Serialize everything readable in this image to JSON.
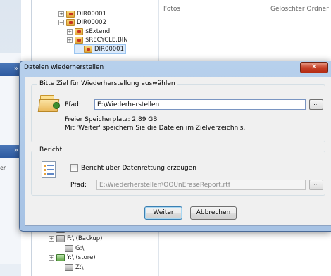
{
  "background": {
    "right_col_headers": [
      "Fotos",
      "Gelöschter Ordner"
    ],
    "left_partial_text": "er",
    "tree_top": [
      {
        "label": "DIR00001",
        "expander": "+",
        "icon": "red"
      },
      {
        "label": "DIR00002",
        "expander": "−",
        "icon": "red"
      },
      {
        "label": "$Extend",
        "expander": "+",
        "icon": "red"
      },
      {
        "label": "$RECYCLE.BIN",
        "expander": "+",
        "icon": "red"
      },
      {
        "label": "DIR00001",
        "expander": "",
        "icon": "red"
      }
    ],
    "tree_bottom": [
      {
        "label": "E:\\ (Volume)",
        "expander": "+",
        "icon": "drive"
      },
      {
        "label": "F:\\ (Backup)",
        "expander": "+",
        "icon": "drive"
      },
      {
        "label": "G:\\",
        "expander": "",
        "icon": "drive"
      },
      {
        "label": "Y:\\ (store)",
        "expander": "+",
        "icon": "net"
      },
      {
        "label": "Z:\\",
        "expander": "",
        "icon": "drive"
      }
    ]
  },
  "dialog": {
    "title": "Dateien wiederherstellen",
    "close_glyph": "✕",
    "target_group": {
      "title": "Bitte Ziel für Wiederherstellung auswählen",
      "path_label": "Pfad:",
      "path_value": "E:\\Wiederherstellen",
      "browse_label": "...",
      "free_space": "Freier Speicherplatz: 2,89 GB",
      "hint": "Mit 'Weiter' speichern Sie die Dateien im Zielverzeichnis."
    },
    "report_group": {
      "title": "Bericht",
      "checkbox_label": "Bericht über Datenrettung erzeugen",
      "checkbox_checked": false,
      "path_label": "Pfad:",
      "path_value": "E:\\Wiederherstellen\\OOUnEraseReport.rtf",
      "browse_label": "..."
    },
    "buttons": {
      "next": "Weiter",
      "cancel": "Abbrechen"
    }
  }
}
